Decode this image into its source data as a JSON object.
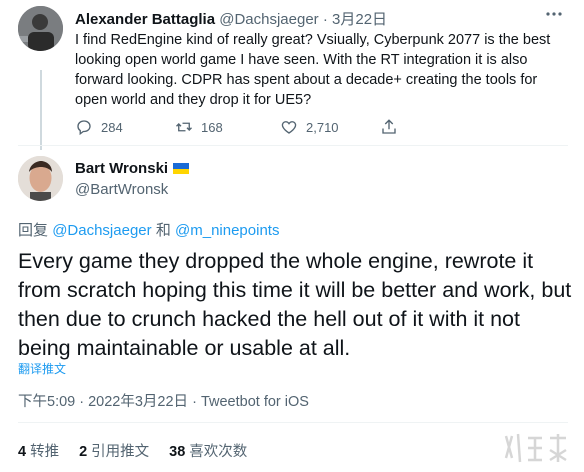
{
  "tweet1": {
    "author_name": "Alexander Battaglia",
    "handle": "@Dachsjaeger",
    "separator": "·",
    "date": "3月22日",
    "text": "I find RedEngine kind of really great? Vsiually, Cyberpunk 2077 is the best looking open world game I have seen. With the RT integration it is also forward looking. CDPR has spent about a decade+ creating the tools for open world and they drop it for UE5?",
    "replies": "284",
    "retweets": "168",
    "likes": "2,710",
    "more_icon": "more-horizontal-icon"
  },
  "tweet2": {
    "author_name": "Bart Wronski",
    "handle": "@BartWronsk",
    "reply_prefix": "回复",
    "reply_mention_1": "@Dachsjaeger",
    "reply_conjunction": "和",
    "reply_mention_2": "@m_ninepoints",
    "text": "Every game they dropped the whole engine, rewrote it from scratch hoping this time it will be better and work, but then due to crunch hacked the hell out of it with it not being maintainable or usable at all.",
    "translate_label": "翻译推文",
    "timestamp": "下午5:09 · 2022年3月22日 · Tweetbot for iOS",
    "stats": {
      "retweets_num": "4",
      "retweets_label": "转推",
      "quotes_num": "2",
      "quotes_label": "引用推文",
      "likes_num": "38",
      "likes_label": "喜欢次数"
    }
  },
  "colors": {
    "accent": "#1d9bf0",
    "secondary_text": "#536471",
    "primary_text": "#0f1419",
    "flag_blue": "#1a6bd6",
    "flag_yellow": "#ffd500"
  }
}
